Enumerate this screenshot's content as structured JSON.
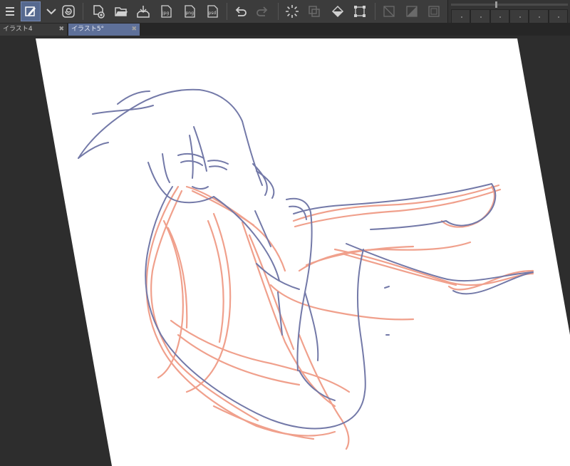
{
  "toolbar": {
    "items": [
      {
        "name": "menu-icon"
      },
      {
        "name": "pen-tool-icon",
        "active": true
      },
      {
        "name": "chevron-down-icon"
      },
      {
        "name": "companion-icon"
      },
      {
        "name": "new-canvas-icon"
      },
      {
        "name": "open-folder-icon"
      },
      {
        "name": "save-icon"
      },
      {
        "name": "export-jpg-icon",
        "label": "jpg"
      },
      {
        "name": "export-png-icon",
        "label": "png"
      },
      {
        "name": "export-psd-icon",
        "label": "psd"
      },
      {
        "name": "undo-icon"
      },
      {
        "name": "redo-icon"
      },
      {
        "name": "loading-icon"
      },
      {
        "name": "layer-icon"
      },
      {
        "name": "fill-icon"
      },
      {
        "name": "transform-icon"
      },
      {
        "name": "clear-selection-icon"
      },
      {
        "name": "invert-selection-icon"
      },
      {
        "name": "border-icon"
      }
    ]
  },
  "tabs": [
    {
      "label": "イラスト4",
      "close": "✖"
    },
    {
      "label": "イラスト5°",
      "close": "✖"
    }
  ],
  "colors": {
    "sketch_red": "#f0a08c",
    "sketch_blue": "#7379a8",
    "canvas": "#ffffff",
    "workspace": "#2d2d2d"
  }
}
